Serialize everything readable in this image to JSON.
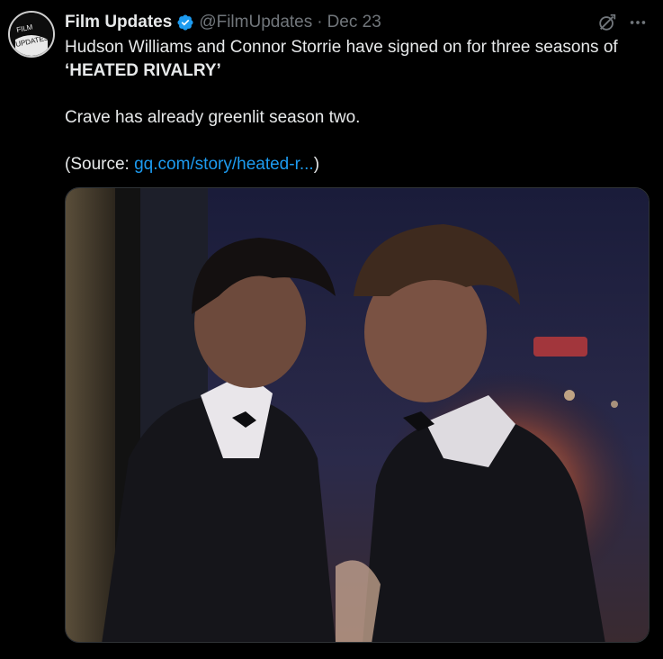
{
  "tweet": {
    "author": {
      "display_name": "Film Updates",
      "handle": "@FilmUpdates",
      "verified_icon": "verified-badge-icon",
      "avatar_text_top": "FILM",
      "avatar_text_bottom": "UPDATES"
    },
    "separator": "·",
    "date": "Dec 23",
    "text": {
      "line1": "Hudson Williams and Connor Storrie have signed on for three seasons of",
      "line2": "‘HEATED RIVALRY’",
      "para2": "Crave has already greenlit season two.",
      "source_open": "(Source: ",
      "source_link": "gq.com/story/heated-r...",
      "source_close": ")"
    },
    "icons": {
      "grok": "grok-icon",
      "more": "more-icon"
    },
    "colors": {
      "background": "#000000",
      "text": "#e7e9ea",
      "secondary": "#71767b",
      "link": "#1d9bf0",
      "verified": "#1d9bf0"
    }
  }
}
